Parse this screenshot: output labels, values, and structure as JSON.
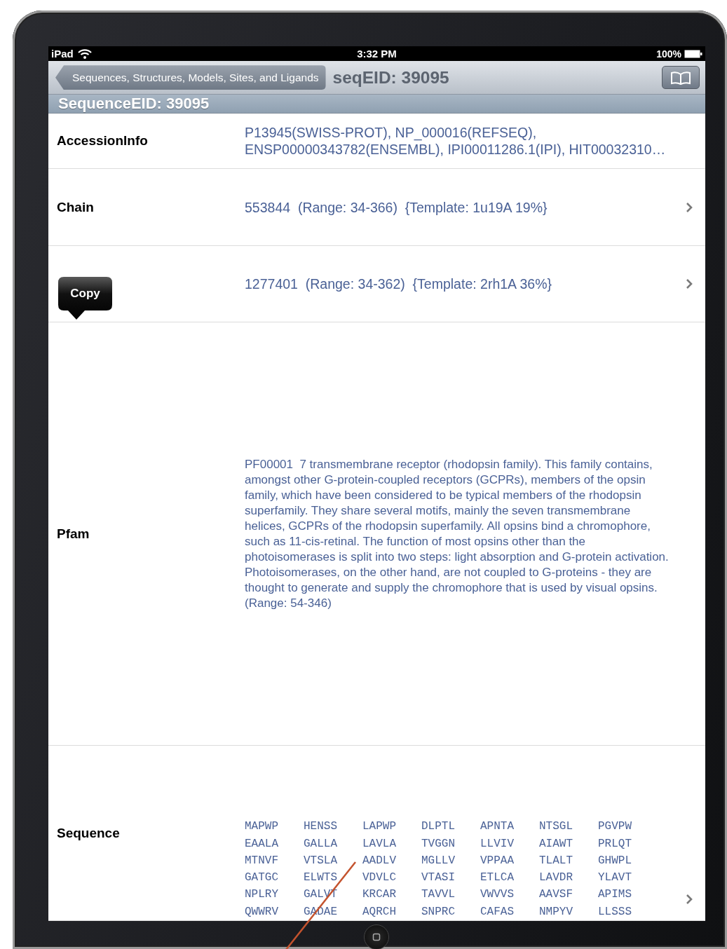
{
  "status_bar": {
    "device": "iPad",
    "time": "3:32 PM",
    "battery": "100%"
  },
  "nav_bar": {
    "back_button": "Sequences, Structures, Models, Sites, and Ligands",
    "title": "seqEID: 39095"
  },
  "section_header": "SequenceEID: 39095",
  "rows": [
    {
      "kind": "text",
      "label": "AccessionInfo",
      "value": "P13945(SWISS-PROT), NP_000016(REFSEQ), ENSP00000343782(ENSEMBL), IPI00011286.1(IPI), HIT00032310…",
      "disclosure": false
    },
    {
      "kind": "text",
      "label": "Chain",
      "value": "553844  (Range: 34-366)  {Template: 1u19A 19%}",
      "disclosure": true
    },
    {
      "kind": "text",
      "popover": "Copy",
      "value": "1277401  (Range: 34-362)  {Template: 2rh1A 36%}",
      "disclosure": true
    },
    {
      "kind": "paragraph",
      "label": "Pfam",
      "value": "PF00001  7 transmembrane receptor (rhodopsin family). This family contains, amongst other G-protein-coupled receptors (GCPRs), members of the opsin family, which have been considered to be typical members of the rhodopsin superfamily. They share several motifs, mainly the seven transmembrane helices, GCPRs of the rhodopsin superfamily. All opsins bind a chromophore, such as 11-cis-retinal. The function of most opsins other than the photoisomerases is split into two steps: light absorption and G-protein activation. Photoisomerases, on the other hand, are not coupled to G-proteins - they are thought to generate and supply the chromophore that is used by visual opsins. (Range: 54-346)",
      "disclosure": false
    },
    {
      "kind": "sequence",
      "label": "Sequence",
      "groups": [
        [
          "MAPWP",
          "HENSS",
          "LAPWP",
          "DLPTL",
          "APNTA",
          "NTSGL",
          "PGVPW"
        ],
        [
          "EAALA",
          "GALLA",
          "LAVLA",
          "TVGGN",
          "LLVIV",
          "AIAWT",
          "PRLQT"
        ],
        [
          "MTNVF",
          "VTSLA",
          "AADLV",
          "MGLLV",
          "VPPAA",
          "TLALT",
          "GHWPL"
        ],
        [
          "GATGC",
          "ELWTS",
          "VDVLC",
          "VTASI",
          "ETLCA",
          "LAVDR",
          "YLAVT"
        ],
        [
          "NPLRY",
          "GALVT",
          "KRCAR",
          "TAVVL",
          "VWVVS",
          "AAVSF",
          "APIMS"
        ],
        [
          "QWWRV",
          "GADAE",
          "AQRCH",
          "SNPRC",
          "CAFAS",
          "NMPYV",
          "LLSSS"
        ]
      ],
      "disclosure": true
    }
  ]
}
